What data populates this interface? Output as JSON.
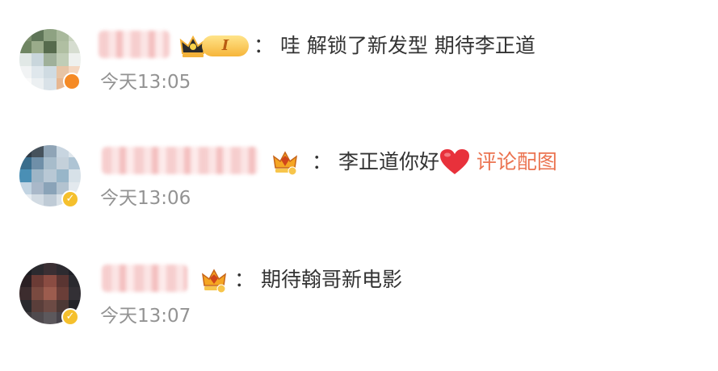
{
  "comments": [
    {
      "text": "：  哇 解锁了新发型 期待李正道",
      "level_label": "I",
      "time": "今天13:05"
    },
    {
      "text": "：  李正道你好",
      "link_label": "评论配图",
      "time": "今天13:06"
    },
    {
      "text": "：  期待翰哥新电影",
      "time": "今天13:07"
    }
  ],
  "colors": {
    "link": "#eb7350",
    "text": "#333333",
    "time": "#939393",
    "heart": "#e8313b",
    "verified_badge_orange": "#f58a25",
    "verified_badge_gold": "#f5c02d"
  },
  "icons": {
    "verified": "✓",
    "heart": "heart-emoji-icon",
    "crown": "crown-icon"
  }
}
